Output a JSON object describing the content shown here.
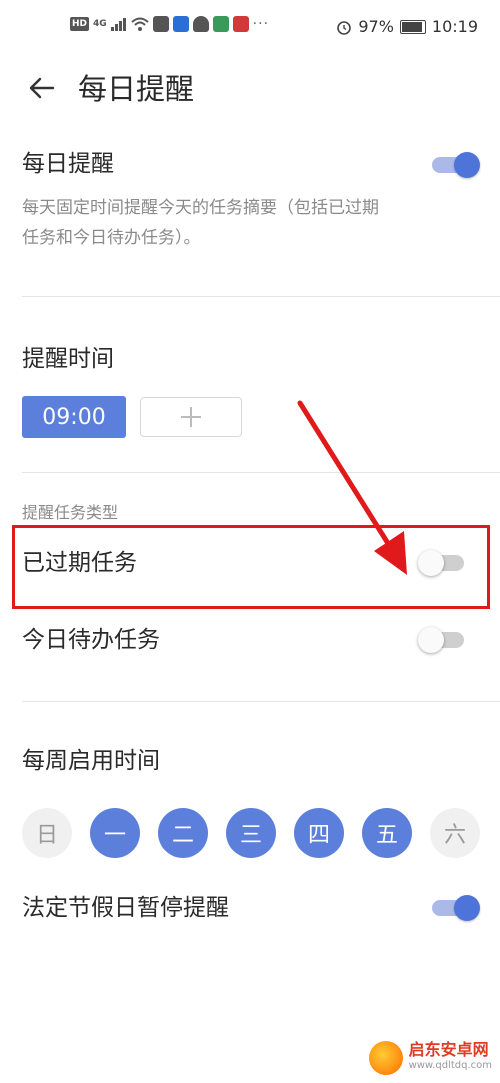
{
  "status_bar": {
    "net_label": "4G",
    "battery": "97%",
    "time": "10:19"
  },
  "header": {
    "title": "每日提醒"
  },
  "daily": {
    "title": "每日提醒",
    "description": "每天固定时间提醒今天的任务摘要（包括已过期任务和今日待办任务）。",
    "enabled": true
  },
  "reminder_time": {
    "title": "提醒时间",
    "times": [
      "09:00"
    ],
    "add_label": "+"
  },
  "task_types": {
    "label": "提醒任务类型",
    "overdue": {
      "label": "已过期任务",
      "enabled": false
    },
    "today": {
      "label": "今日待办任务",
      "enabled": false
    }
  },
  "weekly": {
    "title": "每周启用时间",
    "days": [
      {
        "label": "日",
        "enabled": false
      },
      {
        "label": "一",
        "enabled": true
      },
      {
        "label": "二",
        "enabled": true
      },
      {
        "label": "三",
        "enabled": true
      },
      {
        "label": "四",
        "enabled": true
      },
      {
        "label": "五",
        "enabled": true
      },
      {
        "label": "六",
        "enabled": false
      }
    ]
  },
  "holiday": {
    "title": "法定节假日暂停提醒",
    "enabled": true
  },
  "colors": {
    "accent": "#5b7fdb",
    "switch_on": "#4f74d9",
    "annotation": "#e01a1a"
  },
  "watermark": {
    "name": "启东安卓网",
    "url": "www.qdltdq.com"
  }
}
